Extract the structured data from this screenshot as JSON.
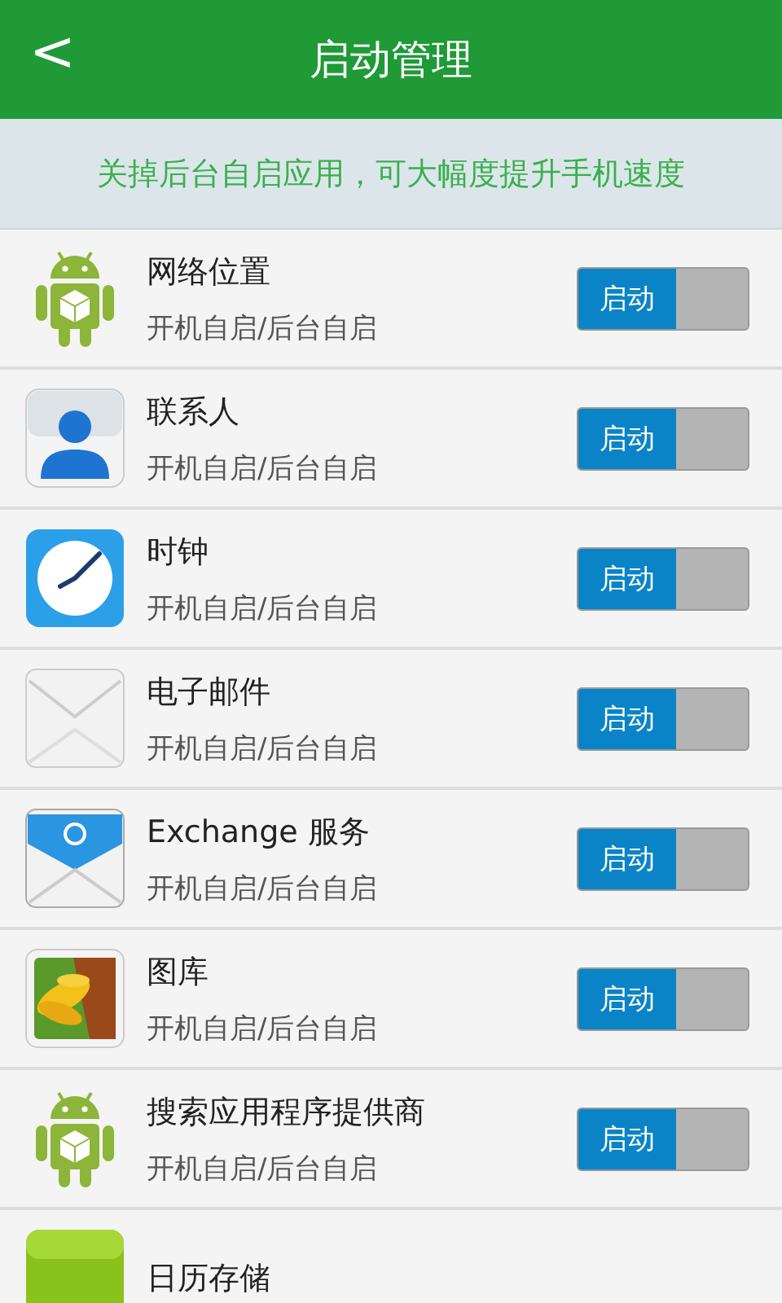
{
  "header": {
    "back": "<",
    "title": "启动管理"
  },
  "banner": "关掉后台自启应用，可大幅度提升手机速度",
  "apps": [
    {
      "name": "网络位置",
      "subtitle": "开机自启/后台自启",
      "toggle": "启动",
      "on": true
    },
    {
      "name": "联系人",
      "subtitle": "开机自启/后台自启",
      "toggle": "启动",
      "on": true
    },
    {
      "name": "时钟",
      "subtitle": "开机自启/后台自启",
      "toggle": "启动",
      "on": true
    },
    {
      "name": "电子邮件",
      "subtitle": "开机自启/后台自启",
      "toggle": "启动",
      "on": true
    },
    {
      "name": "Exchange 服务",
      "subtitle": "开机自启/后台自启",
      "toggle": "启动",
      "on": true
    },
    {
      "name": "图库",
      "subtitle": "开机自启/后台自启",
      "toggle": "启动",
      "on": true
    },
    {
      "name": "搜索应用程序提供商",
      "subtitle": "开机自启/后台自启",
      "toggle": "启动",
      "on": true
    },
    {
      "name": "日历存储"
    }
  ]
}
